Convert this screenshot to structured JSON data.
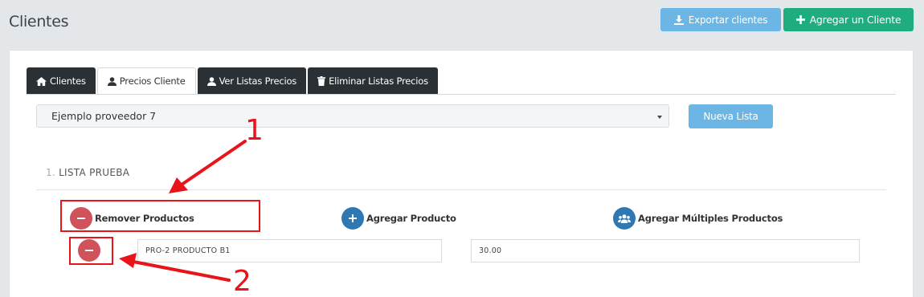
{
  "header": {
    "title": "Clientes",
    "export_label": "Exportar clientes",
    "add_label": "Agregar un Cliente",
    "export_color": "#6cb6e6",
    "add_color": "#1fac7e"
  },
  "tabs": [
    {
      "label": "Clientes",
      "icon": "home-icon",
      "active": false
    },
    {
      "label": "Precios Cliente",
      "icon": "user-icon",
      "active": true
    },
    {
      "label": "Ver Listas Precios",
      "icon": "user-icon",
      "active": false
    },
    {
      "label": "Eliminar Listas Precios",
      "icon": "trash-icon",
      "active": false
    }
  ],
  "provider_select": {
    "value": "Ejemplo proveedor 7"
  },
  "new_list_label": "Nueva Lista",
  "list": {
    "number": "1.",
    "name": "LISTA PRUEBA",
    "actions": {
      "remove": "Remover Productos",
      "add": "Agregar Producto",
      "add_multiple": "Agregar Múltiples Productos"
    },
    "rows": [
      {
        "product": "PRO-2 PRODUCTO B1",
        "price": "30.00"
      }
    ]
  },
  "annotations": {
    "first": "1",
    "second": "2",
    "color": "#e8141a"
  }
}
